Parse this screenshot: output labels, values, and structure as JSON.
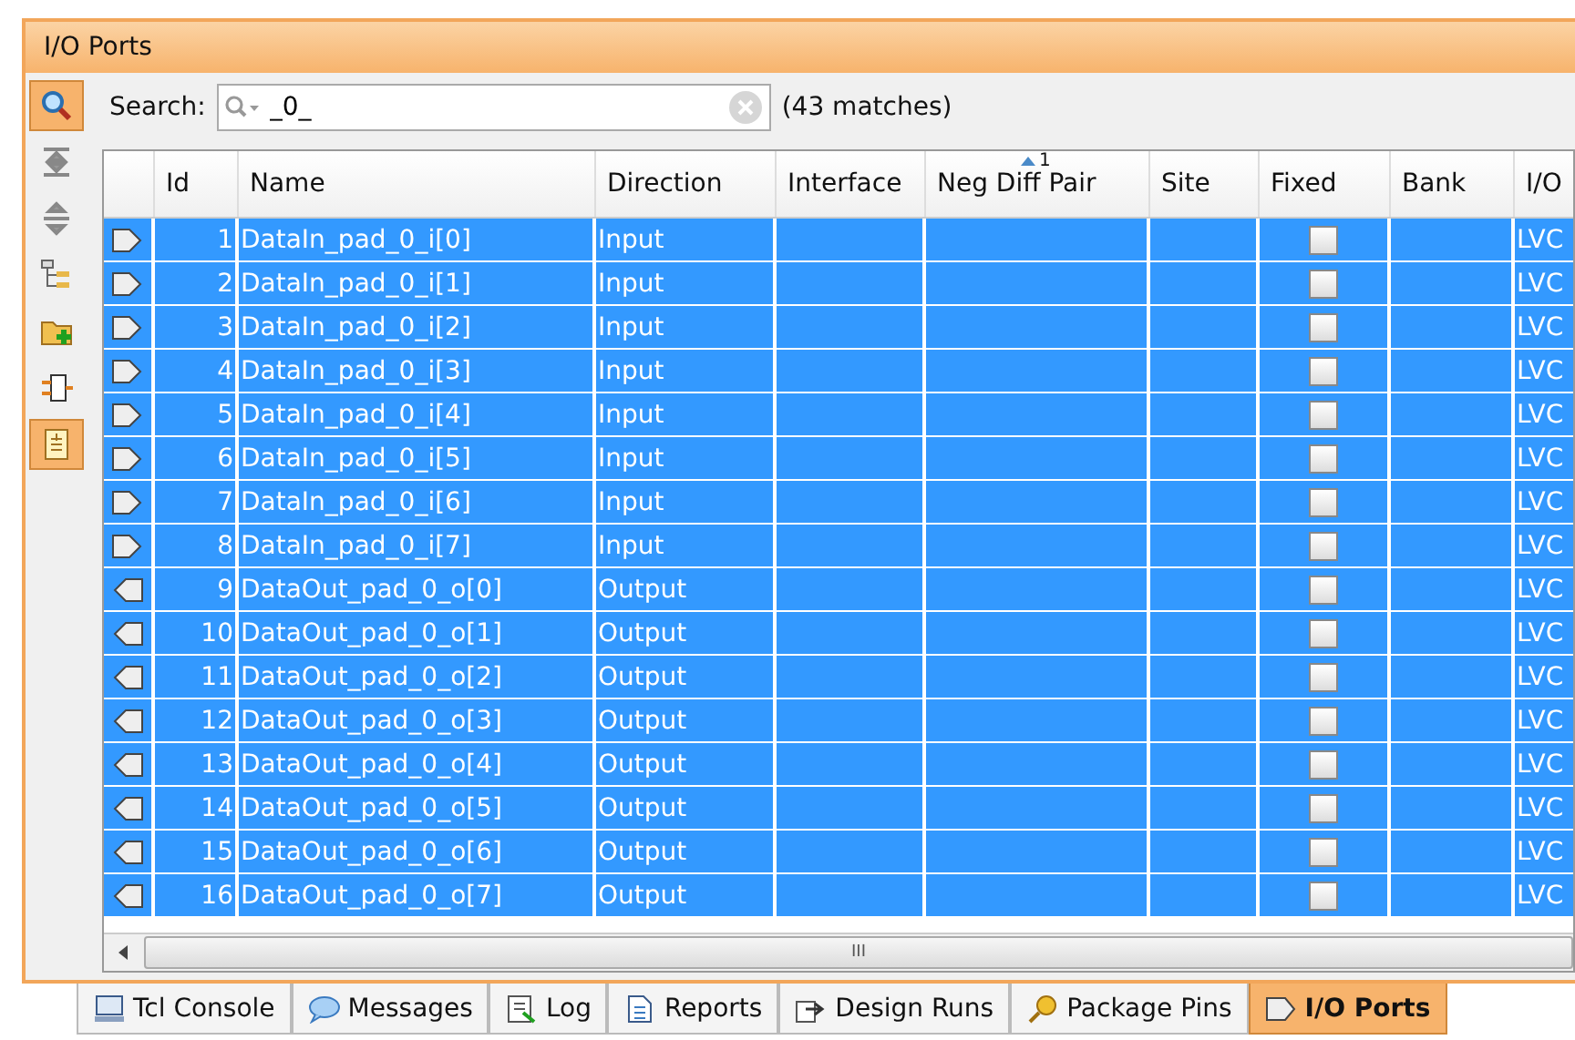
{
  "window": {
    "title": "I/O Ports"
  },
  "toolbar": [
    {
      "selected": true
    },
    {
      "selected": false
    },
    {
      "selected": false
    },
    {
      "selected": false
    },
    {
      "selected": false
    },
    {
      "selected": false
    },
    {
      "selected": true
    }
  ],
  "search": {
    "label": "Search:",
    "value": "_0_",
    "matches": "(43 matches)"
  },
  "table": {
    "columns": [
      "Id",
      "Name",
      "Direction",
      "Interface",
      "Neg Diff Pair",
      "Site",
      "Fixed",
      "Bank",
      "I/O"
    ],
    "sort_index": "1",
    "rows": [
      {
        "kind": "input",
        "id": "1",
        "name": "DataIn_pad_0_i[0]",
        "direction": "Input",
        "fixed": false,
        "io": "LVC",
        "selected": true
      },
      {
        "kind": "input",
        "id": "2",
        "name": "DataIn_pad_0_i[1]",
        "direction": "Input",
        "fixed": false,
        "io": "LVC",
        "selected": true
      },
      {
        "kind": "input",
        "id": "3",
        "name": "DataIn_pad_0_i[2]",
        "direction": "Input",
        "fixed": false,
        "io": "LVC",
        "selected": true
      },
      {
        "kind": "input",
        "id": "4",
        "name": "DataIn_pad_0_i[3]",
        "direction": "Input",
        "fixed": false,
        "io": "LVC",
        "selected": true
      },
      {
        "kind": "input",
        "id": "5",
        "name": "DataIn_pad_0_i[4]",
        "direction": "Input",
        "fixed": false,
        "io": "LVC",
        "selected": true
      },
      {
        "kind": "input",
        "id": "6",
        "name": "DataIn_pad_0_i[5]",
        "direction": "Input",
        "fixed": false,
        "io": "LVC",
        "selected": true
      },
      {
        "kind": "input",
        "id": "7",
        "name": "DataIn_pad_0_i[6]",
        "direction": "Input",
        "fixed": false,
        "io": "LVC",
        "selected": true
      },
      {
        "kind": "input",
        "id": "8",
        "name": "DataIn_pad_0_i[7]",
        "direction": "Input",
        "fixed": false,
        "io": "LVC",
        "selected": true
      },
      {
        "kind": "output",
        "id": "9",
        "name": "DataOut_pad_0_o[0]",
        "direction": "Output",
        "fixed": false,
        "io": "LVC",
        "selected": true
      },
      {
        "kind": "output",
        "id": "10",
        "name": "DataOut_pad_0_o[1]",
        "direction": "Output",
        "fixed": false,
        "io": "LVC",
        "selected": true
      },
      {
        "kind": "output",
        "id": "11",
        "name": "DataOut_pad_0_o[2]",
        "direction": "Output",
        "fixed": false,
        "io": "LVC",
        "selected": true
      },
      {
        "kind": "output",
        "id": "12",
        "name": "DataOut_pad_0_o[3]",
        "direction": "Output",
        "fixed": false,
        "io": "LVC",
        "selected": true
      },
      {
        "kind": "output",
        "id": "13",
        "name": "DataOut_pad_0_o[4]",
        "direction": "Output",
        "fixed": false,
        "io": "LVC",
        "selected": true
      },
      {
        "kind": "output",
        "id": "14",
        "name": "DataOut_pad_0_o[5]",
        "direction": "Output",
        "fixed": false,
        "io": "LVC",
        "selected": true
      },
      {
        "kind": "output",
        "id": "15",
        "name": "DataOut_pad_0_o[6]",
        "direction": "Output",
        "fixed": false,
        "io": "LVC",
        "selected": true
      },
      {
        "kind": "output",
        "id": "16",
        "name": "DataOut_pad_0_o[7]",
        "direction": "Output",
        "fixed": false,
        "io": "LVC",
        "selected": true
      }
    ]
  },
  "scrollbar_grip": "III",
  "tabs": [
    {
      "kind": "console",
      "label": "Tcl Console",
      "selected": false
    },
    {
      "kind": "messages",
      "label": "Messages",
      "selected": false
    },
    {
      "kind": "log",
      "label": "Log",
      "selected": false
    },
    {
      "kind": "reports",
      "label": "Reports",
      "selected": false
    },
    {
      "kind": "runs",
      "label": "Design Runs",
      "selected": false
    },
    {
      "kind": "pins",
      "label": "Package Pins",
      "selected": false
    },
    {
      "kind": "ports",
      "label": "I/O Ports",
      "selected": true
    }
  ]
}
